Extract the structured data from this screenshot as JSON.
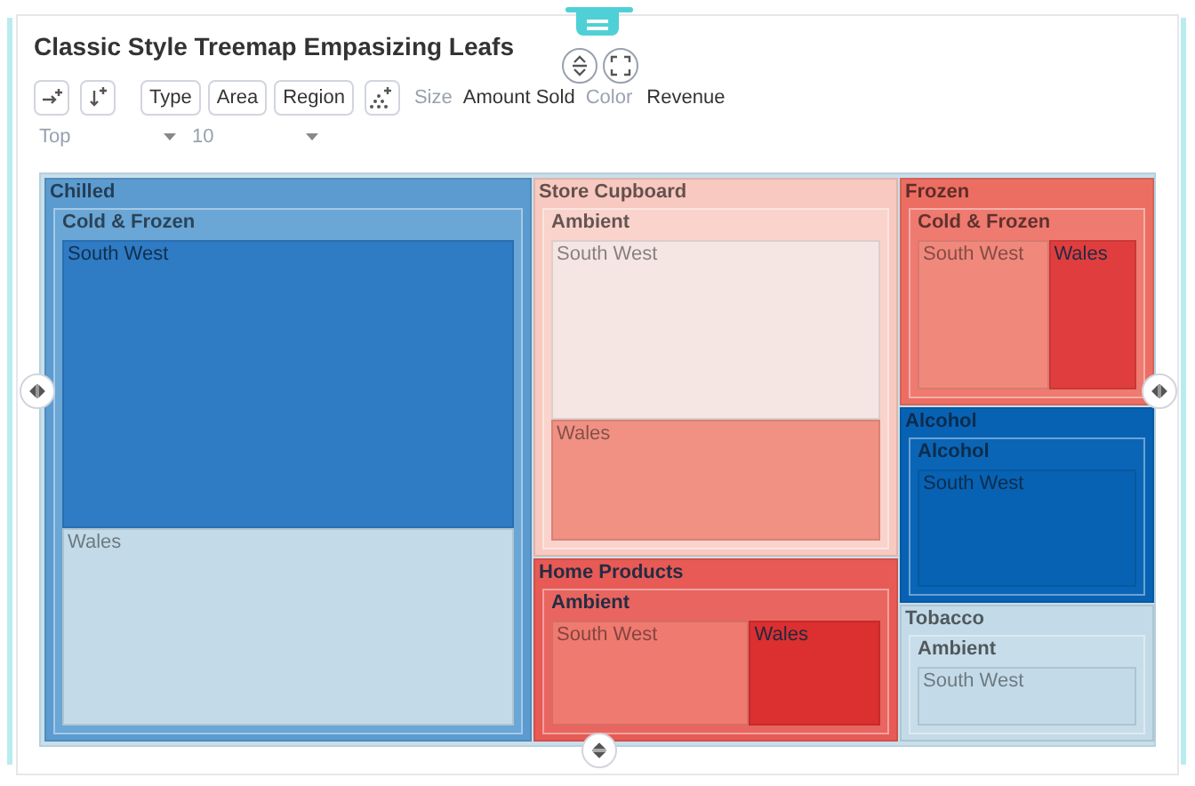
{
  "title": "Classic Style Treemap Empasizing Leafs",
  "toolbar": {
    "buttons": [
      "Type",
      "Area",
      "Region"
    ],
    "size_label": "Size",
    "size_value": "Amount Sold",
    "color_label": "Color",
    "color_value": "Revenue"
  },
  "filters": [
    {
      "value": "Top"
    },
    {
      "value": "10"
    }
  ],
  "treemap": {
    "categories": [
      {
        "name": "Chilled",
        "color": "#5b9bd0",
        "children": [
          {
            "name": "Cold & Frozen",
            "color": "#6aa6d6",
            "children": [
              {
                "name": "South West",
                "color": "#2f7bc4"
              },
              {
                "name": "Wales",
                "color": "#c3dbe8"
              }
            ]
          }
        ]
      },
      {
        "name": "Store Cupboard",
        "color": "#f8c9c0",
        "children": [
          {
            "name": "Ambient",
            "color": "#f9d3cc",
            "children": [
              {
                "name": "South West",
                "color": "#f5e6e3"
              },
              {
                "name": "Wales",
                "color": "#f09184"
              }
            ]
          }
        ]
      },
      {
        "name": "Home Products",
        "color": "#e85a55",
        "children": [
          {
            "name": "Ambient",
            "color": "#e96560",
            "children": [
              {
                "name": "South West",
                "color": "#ef7a70"
              },
              {
                "name": "Wales",
                "color": "#db2f30"
              }
            ]
          }
        ]
      },
      {
        "name": "Frozen",
        "color": "#ec6e63",
        "children": [
          {
            "name": "Cold & Frozen",
            "color": "#ef7a70",
            "children": [
              {
                "name": "South West",
                "color": "#f0887c"
              },
              {
                "name": "Wales",
                "color": "#e03e3e"
              }
            ]
          }
        ]
      },
      {
        "name": "Alcohol",
        "color": "#0862b4",
        "children": [
          {
            "name": "Alcohol",
            "color": "#0a65b6",
            "children": [
              {
                "name": "South West",
                "color": "#0762b3"
              }
            ]
          }
        ]
      },
      {
        "name": "Tobacco",
        "color": "#c3dbe8",
        "children": [
          {
            "name": "Ambient",
            "color": "#c7dde9",
            "children": [
              {
                "name": "South West",
                "color": "#c3dbe8"
              }
            ]
          }
        ]
      }
    ]
  }
}
